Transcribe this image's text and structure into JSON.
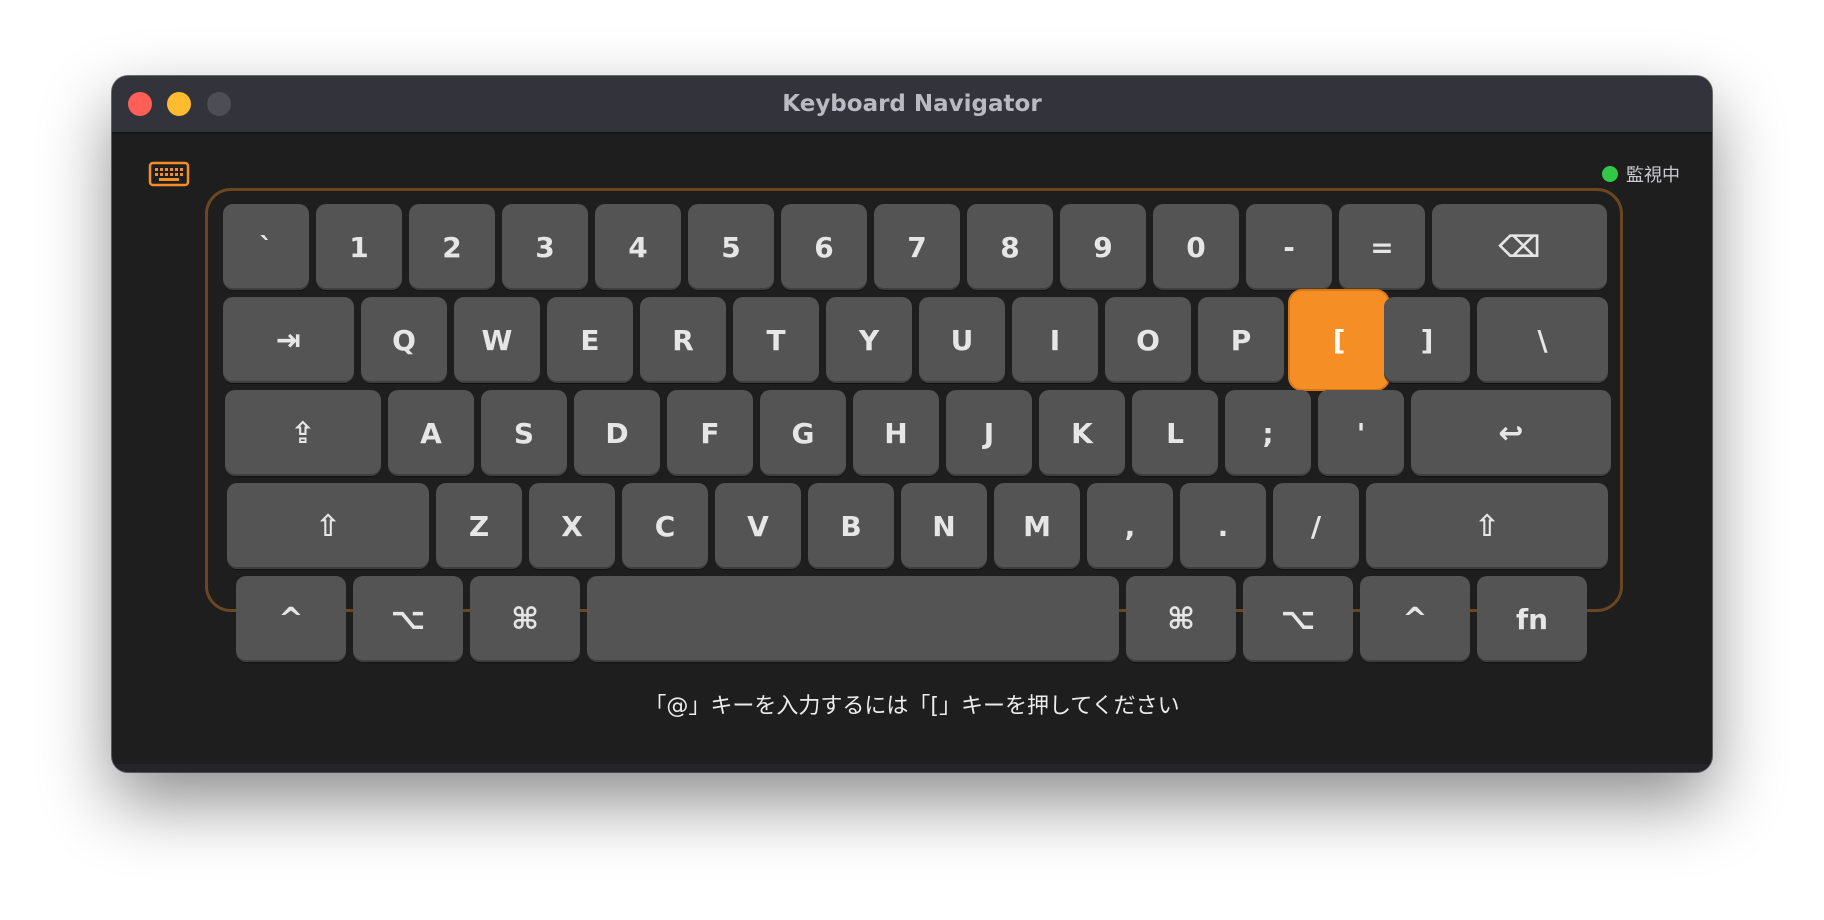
{
  "window": {
    "title": "Keyboard Navigator"
  },
  "status": {
    "label": "監視中",
    "dot_color": "#33c748"
  },
  "accent_color": "#f58f25",
  "keyboard": {
    "highlighted_key": "[",
    "rows": [
      [
        "`",
        "1",
        "2",
        "3",
        "4",
        "5",
        "6",
        "7",
        "8",
        "9",
        "0",
        "-",
        "=",
        "⌫"
      ],
      [
        "⇥",
        "Q",
        "W",
        "E",
        "R",
        "T",
        "Y",
        "U",
        "I",
        "O",
        "P",
        "[",
        "]",
        "\\"
      ],
      [
        "⇪",
        "A",
        "S",
        "D",
        "F",
        "G",
        "H",
        "J",
        "K",
        "L",
        ";",
        "'",
        "↩"
      ],
      [
        "⇧",
        "Z",
        "X",
        "C",
        "V",
        "B",
        "N",
        "M",
        ",",
        ".",
        "/",
        "⇧"
      ],
      [
        "^",
        "⌥",
        "⌘",
        "",
        "⌘",
        "⌥",
        "^",
        "fn"
      ]
    ]
  },
  "hint": {
    "text": "「@」キーを入力するには「[」キーを押してください"
  }
}
